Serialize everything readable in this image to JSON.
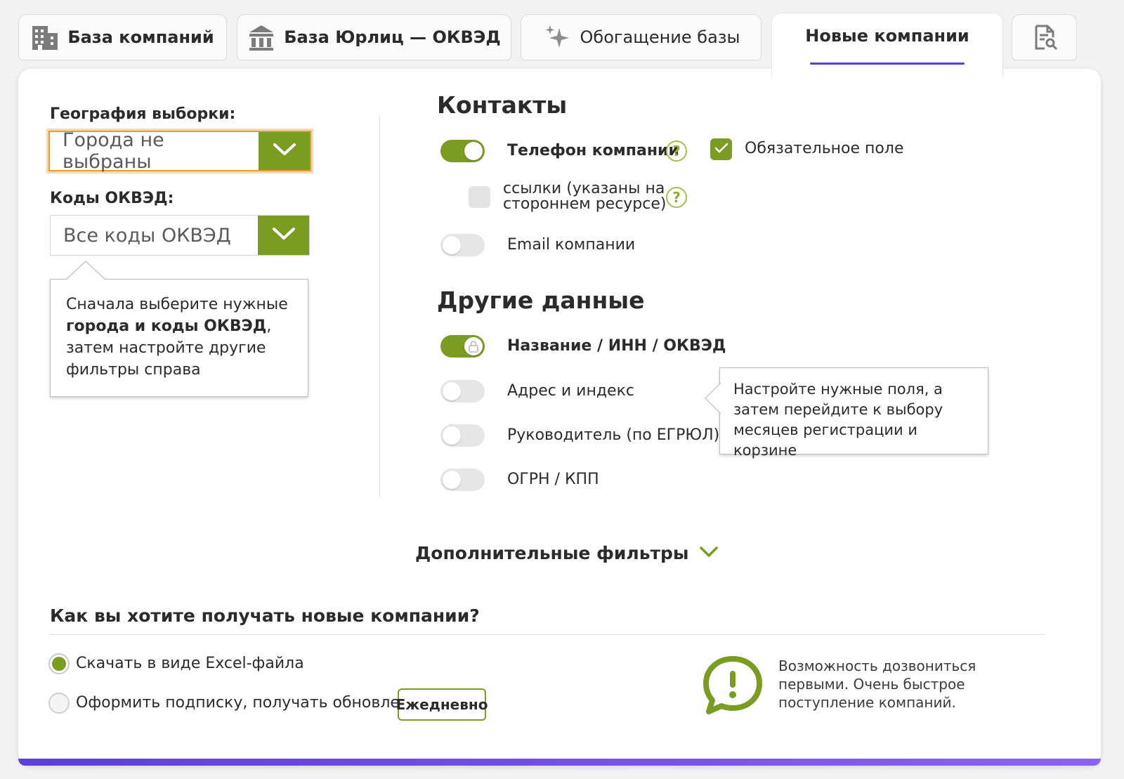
{
  "tabs": [
    {
      "label": "База компаний",
      "icon": "building-icon"
    },
    {
      "label": "База Юрлиц — ОКВЭД",
      "icon": "bank-icon"
    },
    {
      "label": "Обогащение базы",
      "icon": "sparkles-icon"
    },
    {
      "label": "Новые компании",
      "active": true
    },
    {
      "label": "",
      "icon": "document-search-icon"
    }
  ],
  "left": {
    "geo_label": "География выборки:",
    "geo_value": "Города не выбраны",
    "okved_label": "Коды ОКВЭД:",
    "okved_value": "Все коды ОКВЭД",
    "hint_part1": "Сначала выберите нужные ",
    "hint_bold": "города и коды ОКВЭД",
    "hint_part2": ", затем настройте другие фильтры справа"
  },
  "contacts": {
    "title": "Контакты",
    "phone_label": "Телефон компании",
    "phone_on": true,
    "required_label": "Обязательное поле",
    "required_checked": true,
    "links_label_1": "ссылки (указаны на",
    "links_label_2": "стороннем ресурсе)",
    "links_checked": false,
    "email_label": "Email компании",
    "email_on": false
  },
  "other": {
    "title": "Другие данные",
    "name_label": "Название / ИНН / ОКВЭД",
    "name_on": true,
    "address_label": "Адрес и индекс",
    "head_label": "Руководитель (по ЕГРЮЛ)",
    "ogrn_label": "ОГРН / КПП",
    "tooltip": "Настройте нужные поля, а затем перейдите к выбору месяцев регистрации и корзине"
  },
  "extra_filters": "Дополнительные фильтры",
  "delivery": {
    "title": "Как вы хотите получать новые компании?",
    "option_excel": "Скачать в виде Excel-файла",
    "option_subscribe": "Оформить подписку, получать обновления",
    "frequency": "Ежедневно",
    "note": "Возможность дозвониться первыми. Очень быстрое поступление компаний."
  },
  "colors": {
    "accent_green": "#7a9c21",
    "accent_purple": "#5b3fd6"
  }
}
